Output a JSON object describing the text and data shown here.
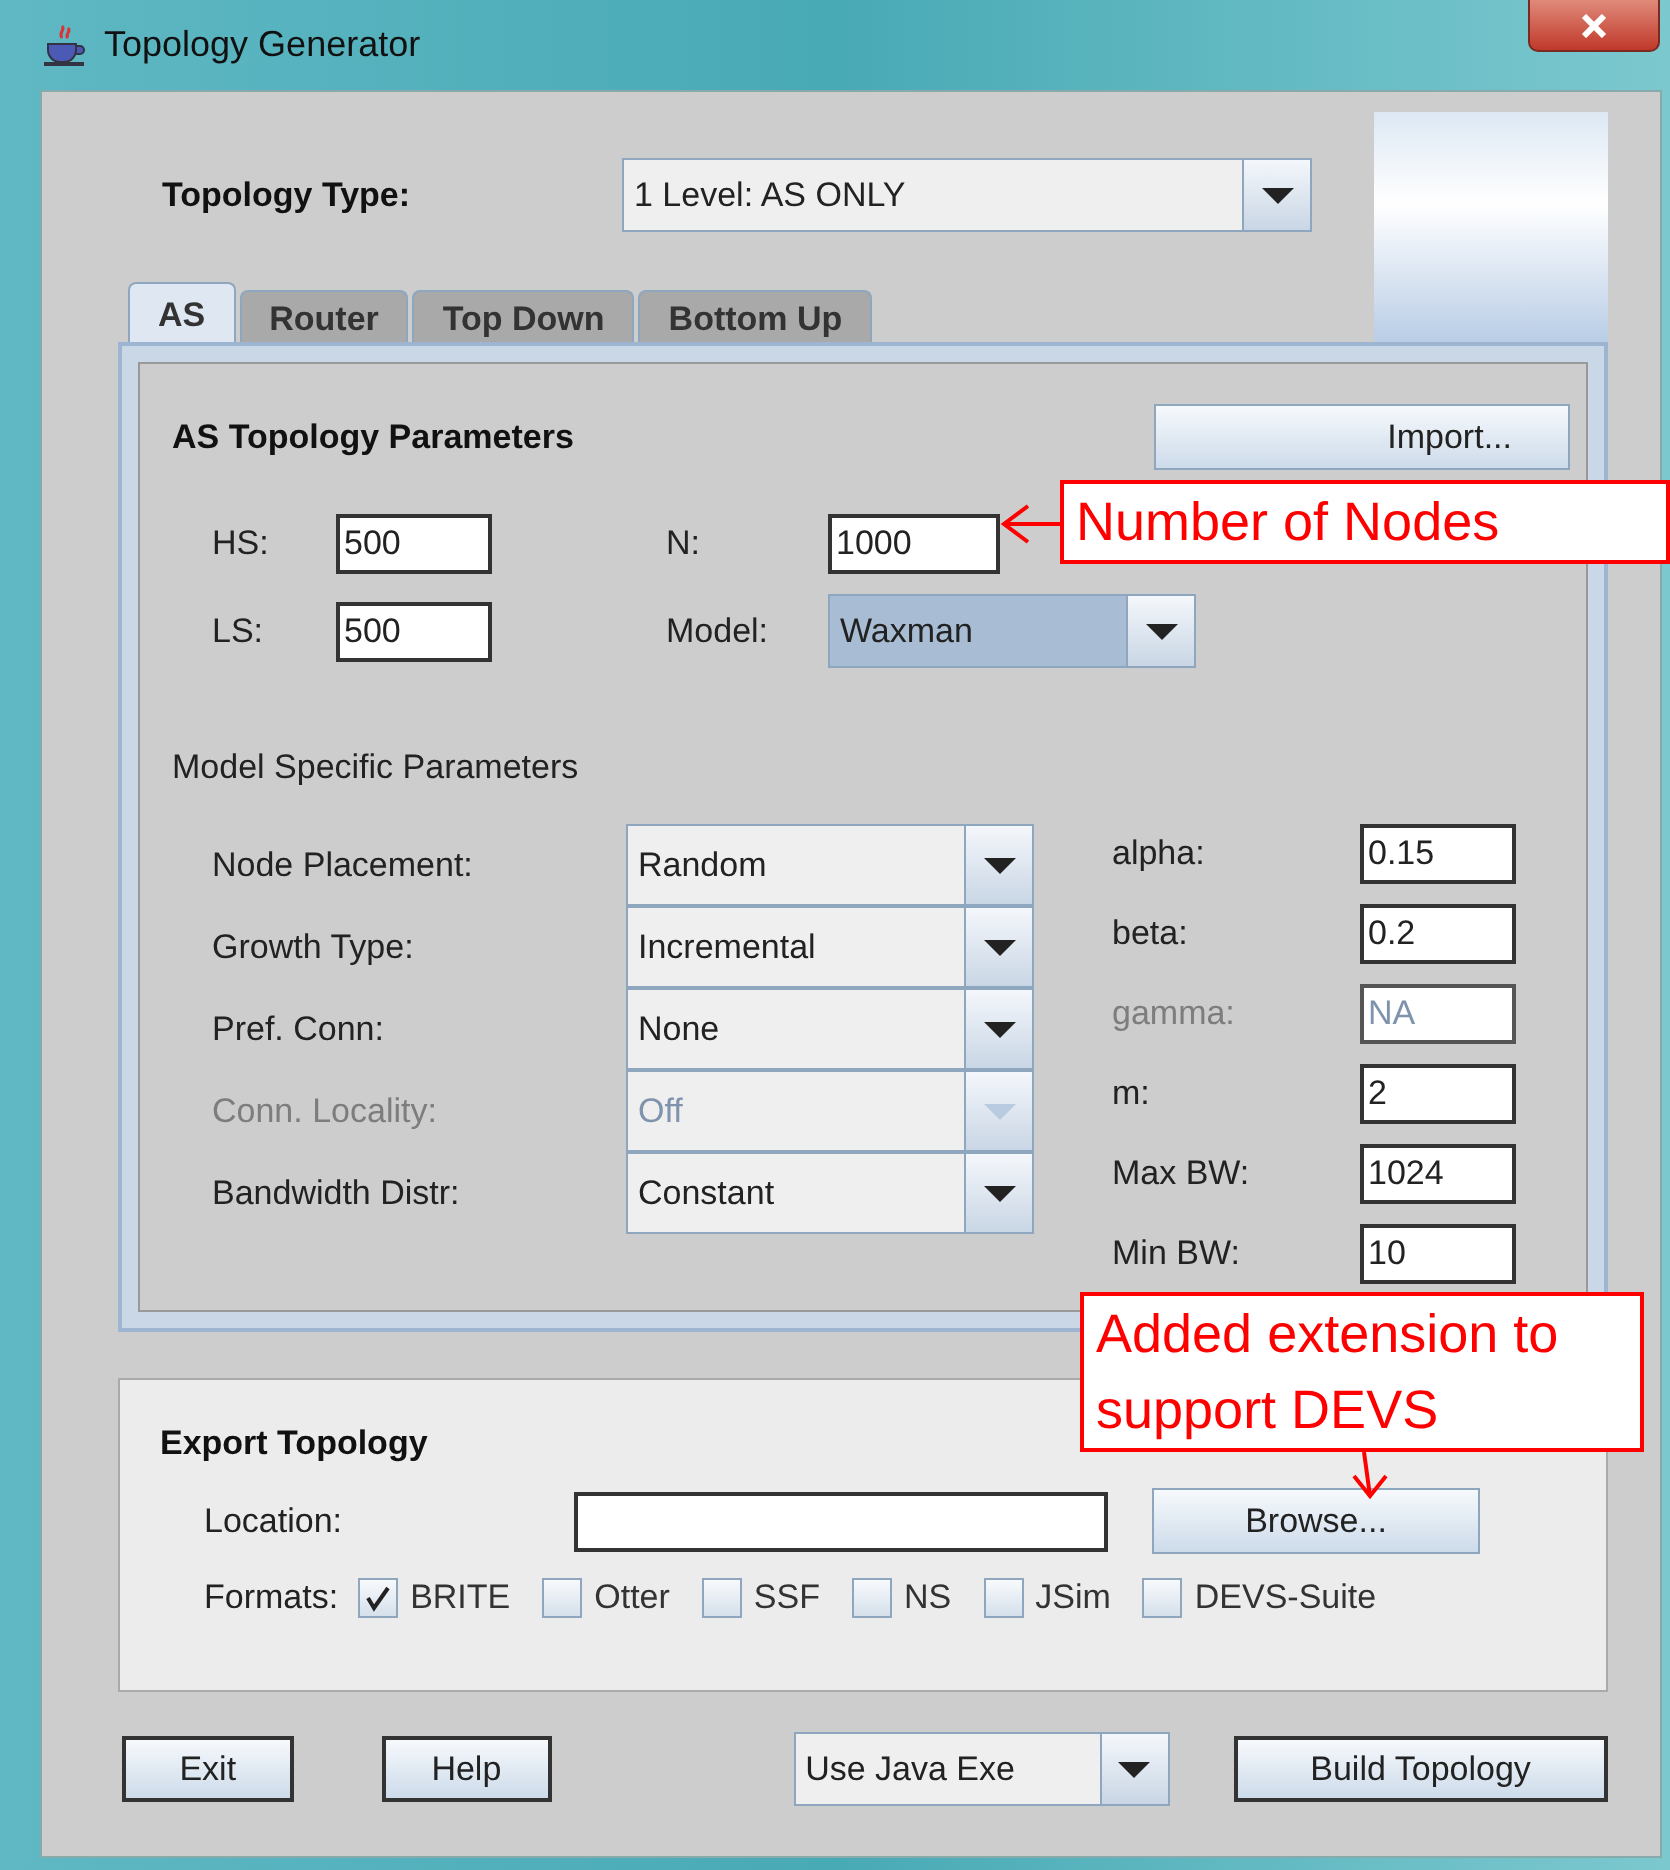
{
  "window": {
    "title": "Topology Generator"
  },
  "topology_type": {
    "label": "Topology Type:",
    "value": "1 Level: AS ONLY"
  },
  "tabs": [
    {
      "label": "AS",
      "selected": true
    },
    {
      "label": "Router",
      "selected": false
    },
    {
      "label": "Top Down",
      "selected": false
    },
    {
      "label": "Bottom Up",
      "selected": false
    }
  ],
  "as_params": {
    "title": "AS Topology Parameters",
    "import_button": "Import...",
    "hs": {
      "label": "HS:",
      "value": "500"
    },
    "ls": {
      "label": "LS:",
      "value": "500"
    },
    "n": {
      "label": "N:",
      "value": "1000"
    },
    "model": {
      "label": "Model:",
      "value": "Waxman"
    }
  },
  "model_specific": {
    "title": "Model Specific Parameters",
    "selects": [
      {
        "label": "Node Placement:",
        "value": "Random",
        "disabled": false
      },
      {
        "label": "Growth Type:",
        "value": "Incremental",
        "disabled": false
      },
      {
        "label": "Pref. Conn:",
        "value": "None",
        "disabled": false
      },
      {
        "label": "Conn. Locality:",
        "value": "Off",
        "disabled": true
      },
      {
        "label": "Bandwidth Distr:",
        "value": "Constant",
        "disabled": false
      }
    ],
    "params": [
      {
        "label": "alpha:",
        "value": "0.15",
        "disabled": false
      },
      {
        "label": "beta:",
        "value": "0.2",
        "disabled": false
      },
      {
        "label": "gamma:",
        "value": "NA",
        "disabled": true
      },
      {
        "label": "m:",
        "value": "2",
        "disabled": false
      },
      {
        "label": "Max BW:",
        "value": "1024",
        "disabled": false
      },
      {
        "label": "Min BW:",
        "value": "10",
        "disabled": false
      }
    ]
  },
  "export": {
    "title": "Export Topology",
    "location_label": "Location:",
    "browse_button": "Browse...",
    "formats_label": "Formats:",
    "formats": [
      {
        "label": "BRITE",
        "checked": true
      },
      {
        "label": "Otter",
        "checked": false
      },
      {
        "label": "SSF",
        "checked": false
      },
      {
        "label": "NS",
        "checked": false
      },
      {
        "label": "JSim",
        "checked": false
      },
      {
        "label": "DEVS-Suite",
        "checked": false
      }
    ]
  },
  "footer": {
    "exit_button": "Exit",
    "help_button": "Help",
    "exe_select": "Use Java Exe",
    "build_button": "Build Topology"
  },
  "annotations": [
    {
      "text": "Number of Nodes"
    },
    {
      "text": "Added extension to support DEVS"
    }
  ]
}
